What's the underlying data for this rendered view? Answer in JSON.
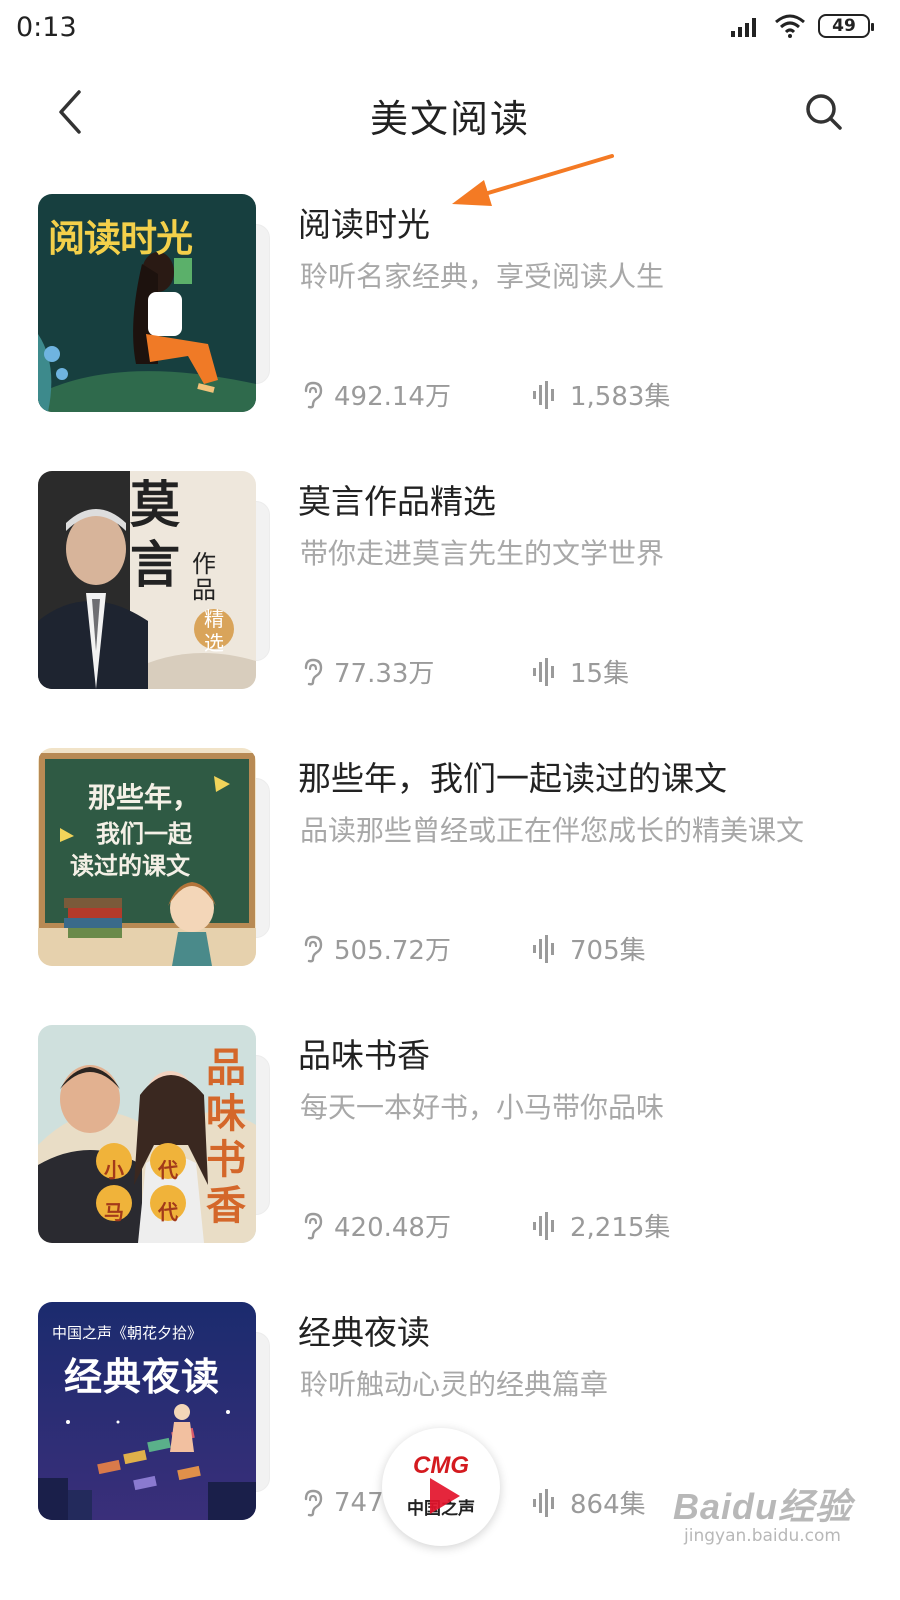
{
  "status_bar": {
    "time": "0:13",
    "battery": "49",
    "signal_icon": "signal-icon",
    "wifi_icon": "wifi-icon"
  },
  "header": {
    "title": "美文阅读",
    "back_icon": "back-arrow-icon",
    "search_icon": "search-icon"
  },
  "accent_color": "#f47a24",
  "items": [
    {
      "title": "阅读时光",
      "description": "聆听名家经典，享受阅读人生",
      "plays": "492.14万",
      "episodes": "1,583集",
      "cover_text": "阅读时光"
    },
    {
      "title": "莫言作品精选",
      "description": "带你走进莫言先生的文学世界",
      "plays": "77.33万",
      "episodes": "15集",
      "cover_text": "莫言",
      "cover_sub": "作品",
      "cover_badge": "精选"
    },
    {
      "title": "那些年，我们一起读过的课文",
      "description": "品读那些曾经或正在伴您成长的精美课文",
      "plays": "505.72万",
      "episodes": "705集",
      "cover_text": "那些年，",
      "cover_sub": "我们一起",
      "cover_badge": "读过的课文"
    },
    {
      "title": "品味书香",
      "description": "每天一本好书，小马带你品味",
      "plays": "420.48万",
      "episodes": "2,215集",
      "cover_text": "品味书香",
      "cover_sub": "小马",
      "cover_badge": "代代"
    },
    {
      "title": "经典夜读",
      "description": "聆听触动心灵的经典篇章",
      "plays": "747",
      "episodes": "864集",
      "cover_text": "经典夜读",
      "cover_sub": "中国之声《朝花夕拾》"
    }
  ],
  "player": {
    "logo": "CMG",
    "station": "中国之声",
    "play_icon": "play-icon"
  },
  "watermark": {
    "main": "Baidu经验",
    "sub": "jingyan.baidu.com"
  }
}
